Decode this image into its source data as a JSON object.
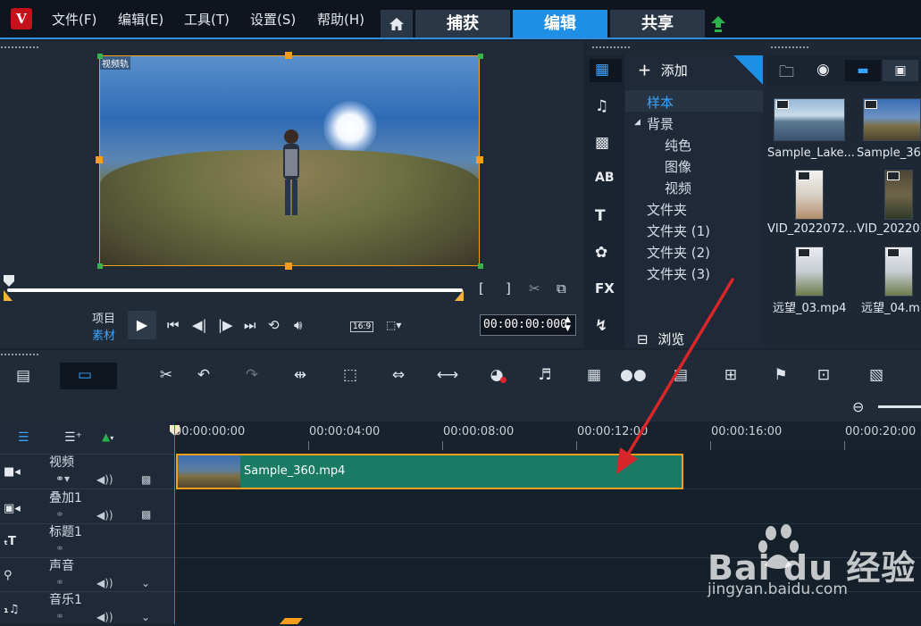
{
  "menu": {
    "items": [
      "文件(F)",
      "编辑(E)",
      "工具(T)",
      "设置(S)",
      "帮助(H)"
    ],
    "tabs": [
      "捕获",
      "编辑",
      "共享"
    ],
    "active_tab": "编辑"
  },
  "preview": {
    "track_label": "视频轨",
    "mode_project": "项目",
    "mode_clip": "素材",
    "aspect": "16:9",
    "timecode": "00:00:00:000"
  },
  "library": {
    "add_label": "添加",
    "tree": [
      {
        "label": "样本",
        "level": 0,
        "selected": true
      },
      {
        "label": "背景",
        "level": 0,
        "expanded": true
      },
      {
        "label": "纯色",
        "level": 1
      },
      {
        "label": "图像",
        "level": 1
      },
      {
        "label": "视频",
        "level": 1
      },
      {
        "label": "文件夹",
        "level": 0
      },
      {
        "label": "文件夹 (1)",
        "level": 0
      },
      {
        "label": "文件夹 (2)",
        "level": 0
      },
      {
        "label": "文件夹 (3)",
        "level": 0
      }
    ],
    "browse_label": "浏览",
    "thumbnails": [
      {
        "label": "Sample_Lake..."
      },
      {
        "label": "Sample_36"
      },
      {
        "label": "VID_2022072..."
      },
      {
        "label": "VID_202207"
      },
      {
        "label": "远望_03.mp4"
      },
      {
        "label": "远望_04.m"
      }
    ]
  },
  "timeline": {
    "ruler": [
      "00:00:00:00",
      "00:00:04:00",
      "00:00:08:00",
      "00:00:12:00",
      "00:00:16:00",
      "00:00:20:00"
    ],
    "tracks": [
      {
        "name": "视频",
        "icon": "video-track-icon"
      },
      {
        "name": "叠加1",
        "icon": "overlay-track-icon"
      },
      {
        "name": "标题1",
        "icon": "title-track-icon"
      },
      {
        "name": "声音",
        "icon": "voice-track-icon"
      },
      {
        "name": "音乐1",
        "icon": "music-track-icon"
      }
    ],
    "clip": {
      "label": "Sample_360.mp4"
    }
  },
  "watermark": {
    "brand": "Bai du 经验",
    "url": "jingyan.baidu.com"
  },
  "colors": {
    "accent": "#1f8fe6",
    "clip": "#1b7a63",
    "handle": "#f79d1c",
    "arrow": "#d9262b"
  }
}
